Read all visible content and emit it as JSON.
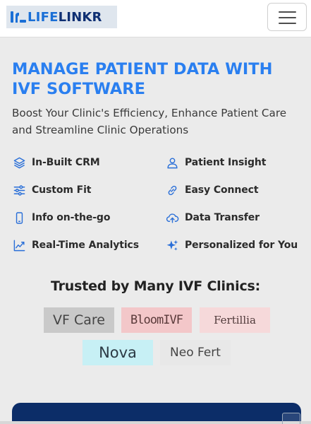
{
  "brand": {
    "name_part1": "LIFE",
    "name_part2": "LINKR",
    "colors": {
      "primary": "#1a6fd6",
      "dark": "#0e2f73"
    }
  },
  "nav": {
    "menu_icon": "hamburger-menu-icon"
  },
  "hero": {
    "title": "MANAGE PATIENT DATA WITH IVF SOFTWARE",
    "subtitle": "Boost Your Clinic's Efficiency, Enhance Patient Care and Streamline Clinic Operations",
    "accent": "#2a7ff0"
  },
  "features": [
    {
      "label": "In-Built CRM",
      "icon": "layers-icon"
    },
    {
      "label": "Patient Insight",
      "icon": "user-icon"
    },
    {
      "label": "Custom Fit",
      "icon": "sliders-icon"
    },
    {
      "label": "Easy Connect",
      "icon": "link-icon"
    },
    {
      "label": "Info on-the-go",
      "icon": "mobile-icon"
    },
    {
      "label": "Data Transfer",
      "icon": "cloud-upload-icon"
    },
    {
      "label": "Real-Time Analytics",
      "icon": "trending-up-icon"
    },
    {
      "label": "Personalized for You",
      "icon": "sparkles-icon"
    }
  ],
  "trusted": {
    "heading": "Trusted by Many IVF Clinics:",
    "clinics": [
      "VF Care",
      "BloomIVF",
      "Fertillia",
      "Nova",
      "Neo Fert"
    ]
  },
  "footer_panel": {
    "color": "#0c2d68"
  }
}
